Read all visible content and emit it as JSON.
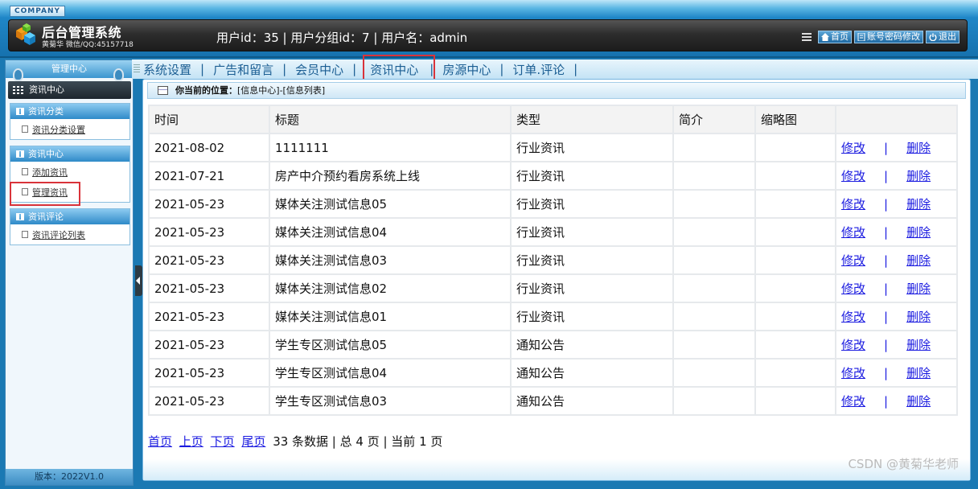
{
  "header": {
    "company": "COMPANY",
    "title": "后台管理系统",
    "author": "黄菊华 微信/QQ:45157718",
    "user_info": "用户id：35 | 用户分组id：7 | 用户名：admin",
    "buttons": [
      "首页",
      "账号密码修改",
      "退出"
    ]
  },
  "sidebar": {
    "heading": "管理中心",
    "current": "资讯中心",
    "groups": [
      {
        "title": "资讯分类",
        "items": [
          "资讯分类设置"
        ]
      },
      {
        "title": "资讯中心",
        "items": [
          "添加资讯",
          "管理资讯"
        ]
      },
      {
        "title": "资讯评论",
        "items": [
          "资讯评论列表"
        ]
      }
    ],
    "version": "版本：2022V1.0"
  },
  "nav": {
    "items": [
      "系统设置",
      "广告和留言",
      "会员中心",
      "资讯中心",
      "房源中心",
      "订单.评论"
    ],
    "active": "资讯中心"
  },
  "location": {
    "label": "你当前的位置：",
    "path": "[信息中心]-[信息列表]"
  },
  "table": {
    "columns": [
      "时间",
      "标题",
      "类型",
      "简介",
      "缩略图",
      ""
    ],
    "edit_label": "修改",
    "delete_label": "删除",
    "rows": [
      {
        "time": "2021-08-02",
        "title": "1111111",
        "type": "行业资讯",
        "intro": "",
        "thumb": ""
      },
      {
        "time": "2021-07-21",
        "title": "房产中介预约看房系统上线",
        "type": "行业资讯",
        "intro": "",
        "thumb": ""
      },
      {
        "time": "2021-05-23",
        "title": "媒体关注测试信息05",
        "type": "行业资讯",
        "intro": "",
        "thumb": ""
      },
      {
        "time": "2021-05-23",
        "title": "媒体关注测试信息04",
        "type": "行业资讯",
        "intro": "",
        "thumb": ""
      },
      {
        "time": "2021-05-23",
        "title": "媒体关注测试信息03",
        "type": "行业资讯",
        "intro": "",
        "thumb": ""
      },
      {
        "time": "2021-05-23",
        "title": "媒体关注测试信息02",
        "type": "行业资讯",
        "intro": "",
        "thumb": ""
      },
      {
        "time": "2021-05-23",
        "title": "媒体关注测试信息01",
        "type": "行业资讯",
        "intro": "",
        "thumb": ""
      },
      {
        "time": "2021-05-23",
        "title": "学生专区测试信息05",
        "type": "通知公告",
        "intro": "",
        "thumb": ""
      },
      {
        "time": "2021-05-23",
        "title": "学生专区测试信息04",
        "type": "通知公告",
        "intro": "",
        "thumb": ""
      },
      {
        "time": "2021-05-23",
        "title": "学生专区测试信息03",
        "type": "通知公告",
        "intro": "",
        "thumb": ""
      }
    ]
  },
  "pager": {
    "links": [
      "首页",
      "上页",
      "下页",
      "尾页"
    ],
    "summary": "33 条数据 | 总 4 页 | 当前 1 页"
  },
  "watermark": "CSDN @黄菊华老师",
  "colors": {
    "highlight_box": "#d9333a",
    "link": "#1a1ae0",
    "header_blue": "#1f86c7"
  }
}
